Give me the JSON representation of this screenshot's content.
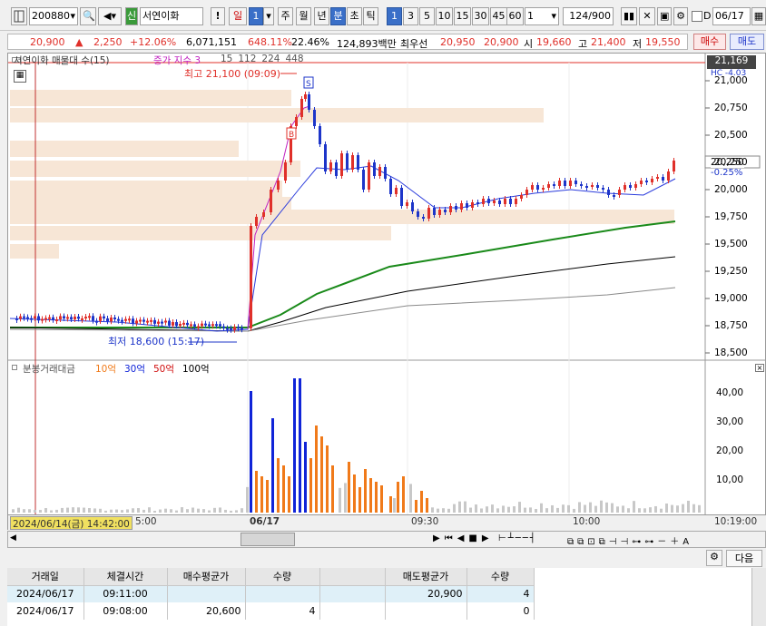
{
  "toolbar": {
    "code": "200880",
    "market_badge": "신",
    "stock_name": "서연이화",
    "alert": "!",
    "period_day": "일",
    "day_n": "1",
    "periods": [
      "주",
      "월",
      "년",
      "분",
      "초",
      "틱"
    ],
    "intervals": [
      "1",
      "3",
      "5",
      "10",
      "15",
      "30",
      "45",
      "60"
    ],
    "interval_custom": "1",
    "count": "124/900",
    "checkbox_label": "D",
    "date": "06/17"
  },
  "quote": {
    "price": "20,900",
    "change_arrow": "▲",
    "change": "2,250",
    "change_pct": "+12.06%",
    "volume": "6,071,151",
    "turnover_pct": "648.11%",
    "ratio": "22.46%",
    "amount": "124,893백만",
    "best_label": "최우선",
    "best_ask": "20,950",
    "best_bid": "20,900",
    "open_label": "시",
    "open": "19,660",
    "high_label": "고",
    "high": "21,400",
    "low_label": "저",
    "low": "19,550",
    "buy_label": "매수",
    "sell_label": "매도"
  },
  "colors": {
    "up": "#e0302a",
    "down": "#1d35c9",
    "ma5": "#2a3bdc",
    "ma20": "#1a8a1a",
    "ma60": "#000000",
    "ma120": "#8a8a8a",
    "bar_orange": "#f07a1a",
    "bar_blue": "#1024d8",
    "bar_gray": "#c8c8c8"
  },
  "price_panel": {
    "title": "서연이화 매물대 수(15)",
    "indicator": "증가 지수 3",
    "ma_periods": [
      "15",
      "112",
      "224",
      "448"
    ],
    "high_note": "최고 21,100 (09:09)",
    "low_note": "최저 18,600 (15:17)",
    "last_price_tag": "21,169",
    "tag_partial": "HC -4.03",
    "current_price": "20,250",
    "current_pct": "-0.25%",
    "y_ticks": [
      "21,000",
      "20,750",
      "20,500",
      "20,250",
      "20,000",
      "19,750",
      "19,500",
      "19,250",
      "19,000",
      "18,750",
      "18,500"
    ],
    "marker_buy": "B",
    "marker_sell": "S"
  },
  "volume_panel": {
    "title": "분봉거래대금",
    "legend": [
      "10억",
      "30억",
      "50억",
      "100억"
    ],
    "y_ticks": [
      "40,00",
      "30,00",
      "20,00",
      "10,00"
    ]
  },
  "time_axis": {
    "cursor_label": "2024/06/14(금) 14:42:00",
    "labels": [
      "5:00",
      "06/17",
      "09:30",
      "10:00",
      "10:19:00"
    ]
  },
  "bottom_toolbar": {
    "next_label": "다음"
  },
  "trades": {
    "columns": [
      "거래일",
      "체결시간",
      "매수평균가",
      "수량",
      "",
      "매도평균가",
      "수량"
    ],
    "rows": [
      [
        "2024/06/17",
        "09:11:00",
        "",
        "",
        "",
        "20,900",
        "4"
      ],
      [
        "2024/06/17",
        "09:08:00",
        "20,600",
        "4",
        "",
        "",
        "0"
      ]
    ]
  }
}
